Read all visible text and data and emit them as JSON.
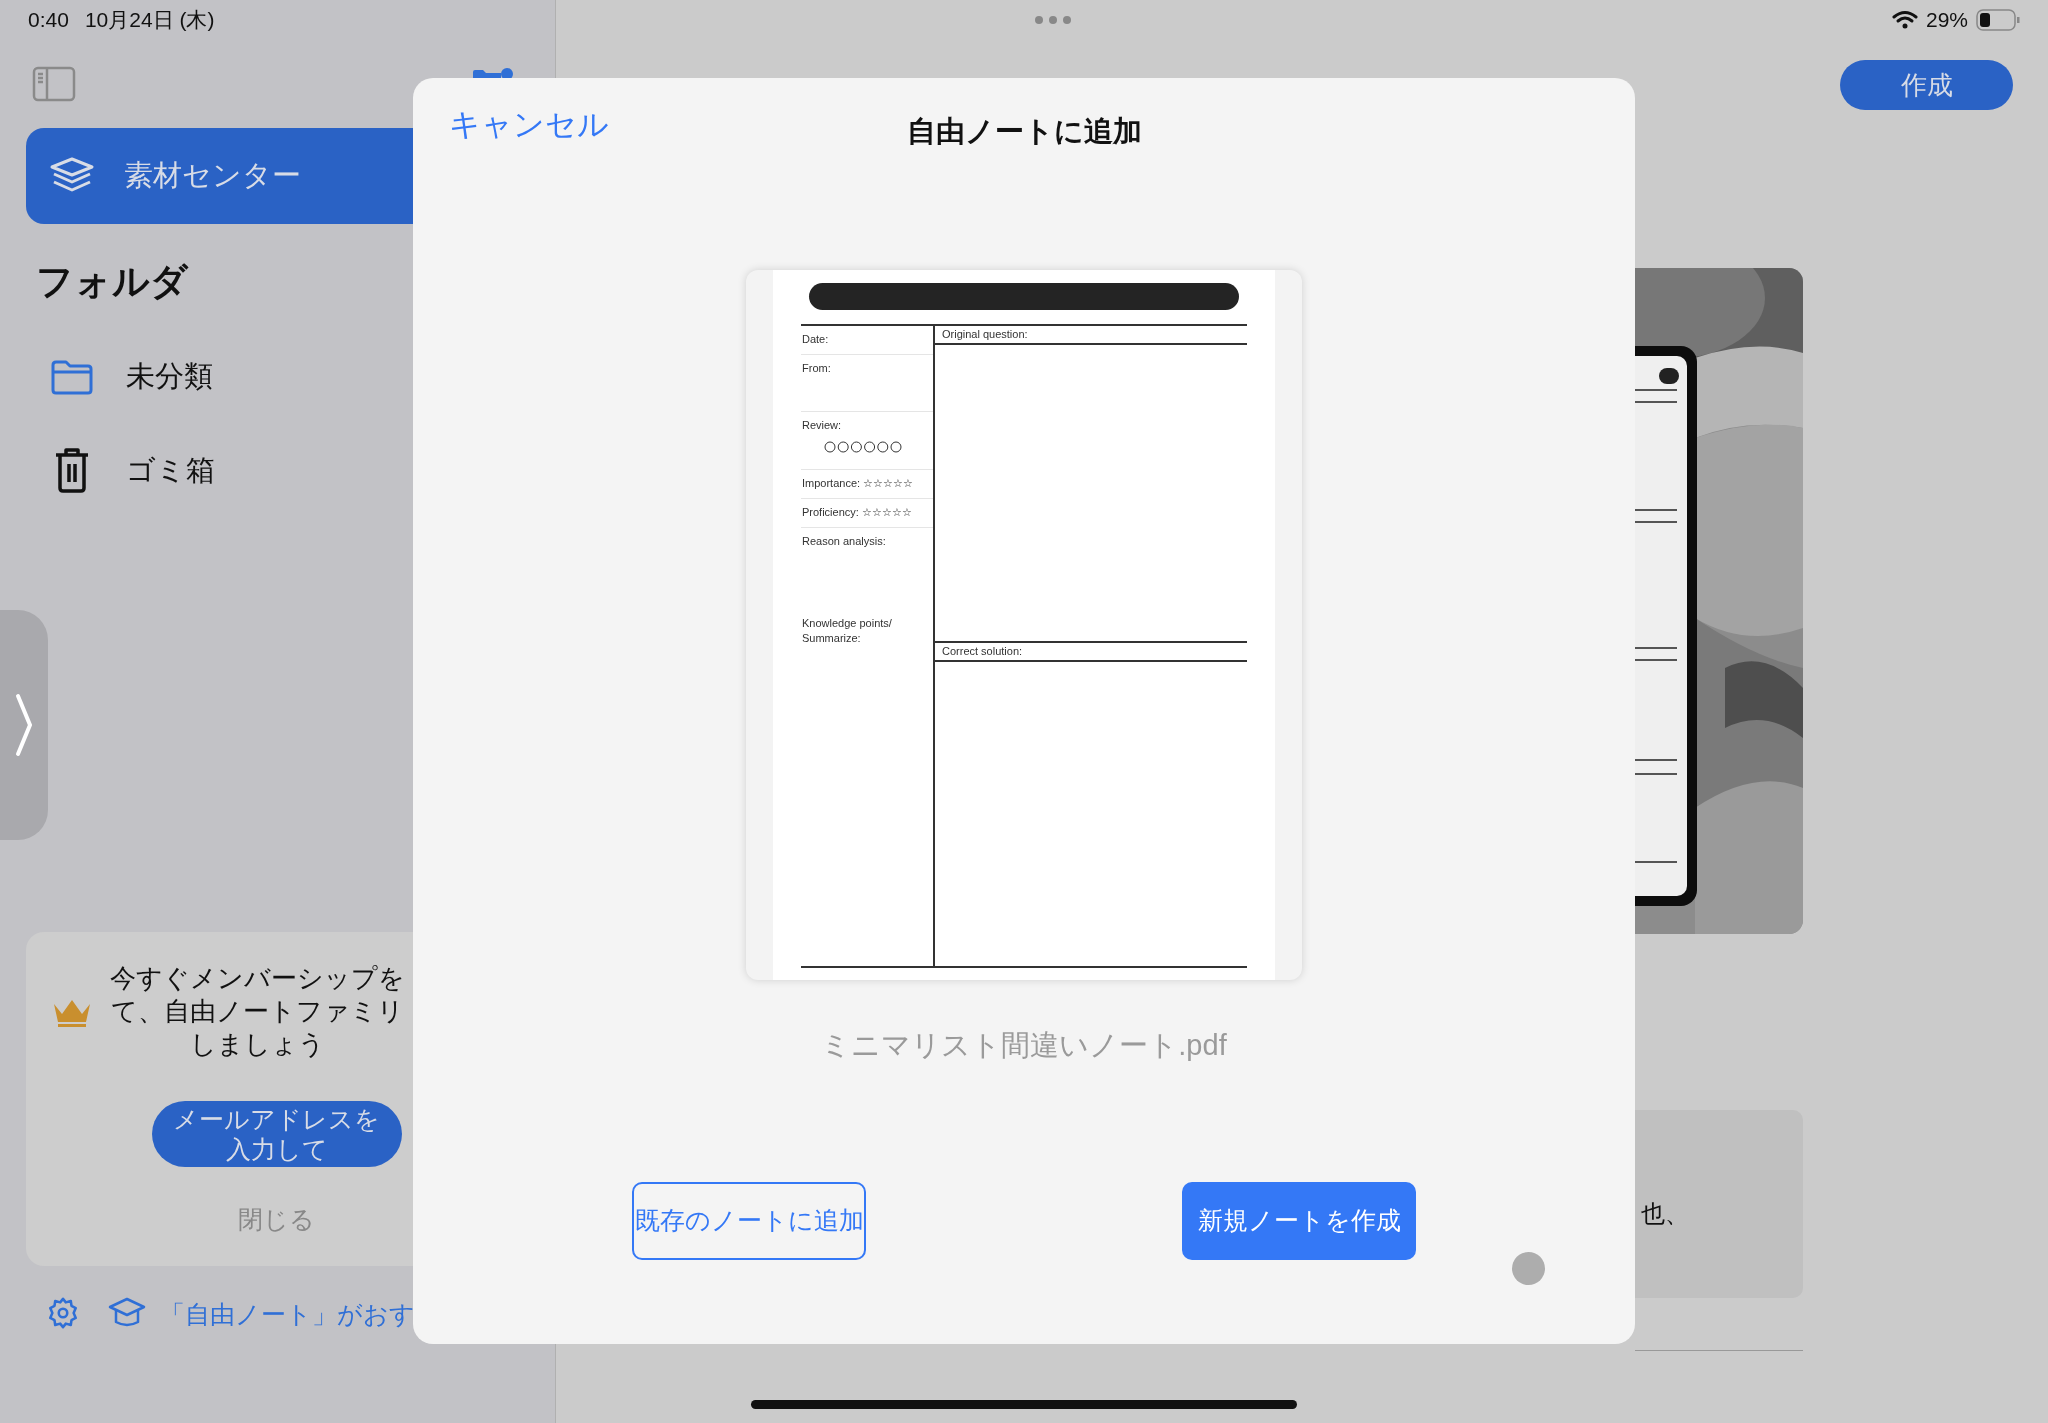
{
  "status_bar": {
    "time": "0:40",
    "date": "10月24日 (木)",
    "battery": "29%"
  },
  "sidebar": {
    "nav": [
      {
        "label": "素材センター",
        "selected": true
      }
    ],
    "section_title": "フォルダ",
    "folders": [
      {
        "label": "未分類",
        "kind": "folder",
        "selected": false
      },
      {
        "label": "ゴミ箱",
        "kind": "trash",
        "selected": false
      }
    ],
    "promo": {
      "lines": [
        "今すぐメンバーシップを",
        "て、自由ノートファミリ",
        "しましょう"
      ],
      "button": "メールアドレスを入力して",
      "dismiss": "閉じる"
    },
    "footer_link": "「自由ノート」がおす"
  },
  "main": {
    "create_button": "作成",
    "card_text": "也、"
  },
  "dialog": {
    "cancel": "キャンセル",
    "title": "自由ノートに追加",
    "document": {
      "left_fields": [
        {
          "label": "Date:",
          "kind": "short"
        },
        {
          "label": "From:",
          "kind": "tall"
        },
        {
          "label": "Review:",
          "kind": "circles"
        },
        {
          "label": "Importance: ☆☆☆☆☆",
          "kind": "short"
        },
        {
          "label": "Proficiency: ☆☆☆☆☆",
          "kind": "short"
        },
        {
          "label": "Reason analysis:",
          "kind": "open"
        },
        {
          "label": "Knowledge points/ Summarize:",
          "kind": "rest"
        }
      ],
      "right_sections": [
        "Original question:",
        "Correct solution:"
      ]
    },
    "filename": "ミニマリスト間違いノート.pdf",
    "buttons": [
      {
        "label": "既存のノートに追加",
        "kind": "outline"
      },
      {
        "label": "新規ノートを作成",
        "kind": "primary"
      }
    ]
  }
}
